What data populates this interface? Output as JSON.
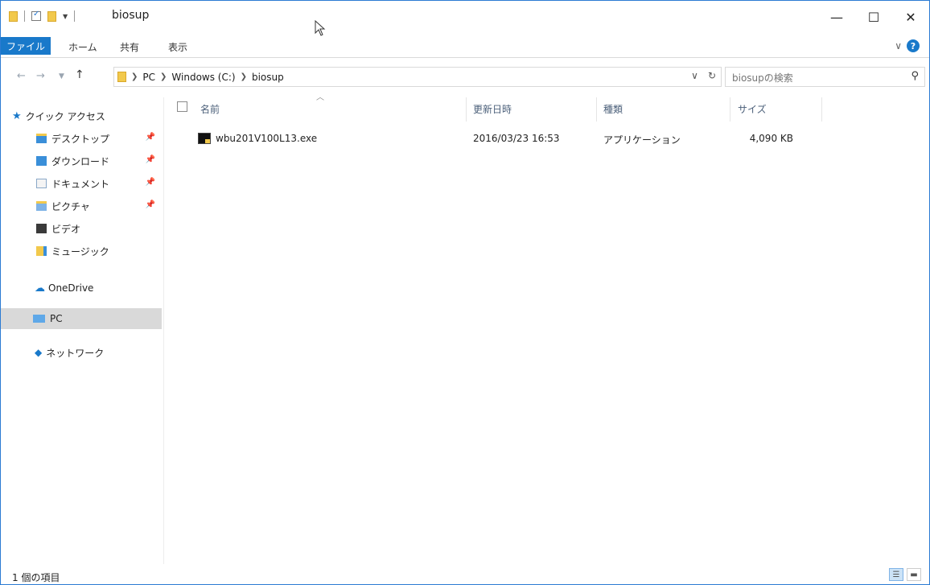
{
  "window": {
    "title": "biosup",
    "minimize": "—",
    "maximize": "☐",
    "close": "✕"
  },
  "ribbon": {
    "file_tab": "ファイル",
    "tabs": [
      "ホーム",
      "共有",
      "表示"
    ]
  },
  "address": {
    "crumbs": [
      "PC",
      "Windows (C:)",
      "biosup"
    ],
    "search_placeholder": "biosupの検索"
  },
  "navpane": {
    "quick_access": "クイック アクセス",
    "items": [
      {
        "label": "デスクトップ",
        "pinned": true,
        "icon": "desktop-folder-icon"
      },
      {
        "label": "ダウンロード",
        "pinned": true,
        "icon": "downloads-folder-icon"
      },
      {
        "label": "ドキュメント",
        "pinned": true,
        "icon": "documents-folder-icon"
      },
      {
        "label": "ピクチャ",
        "pinned": true,
        "icon": "pictures-folder-icon"
      },
      {
        "label": "ビデオ",
        "pinned": false,
        "icon": "videos-folder-icon"
      },
      {
        "label": "ミュージック",
        "pinned": false,
        "icon": "music-folder-icon"
      }
    ],
    "onedrive": "OneDrive",
    "pc": "PC",
    "network": "ネットワーク"
  },
  "columns": {
    "name": "名前",
    "modified": "更新日時",
    "type": "種類",
    "size": "サイズ"
  },
  "files": [
    {
      "name": "wbu201V100L13.exe",
      "modified": "2016/03/23 16:53",
      "type": "アプリケーション",
      "size": "4,090 KB",
      "icon": "exe-app-icon"
    }
  ],
  "status": {
    "count": "1 個の項目"
  },
  "colors": {
    "accent": "#1979ca",
    "selection": "#d9d9d9"
  }
}
